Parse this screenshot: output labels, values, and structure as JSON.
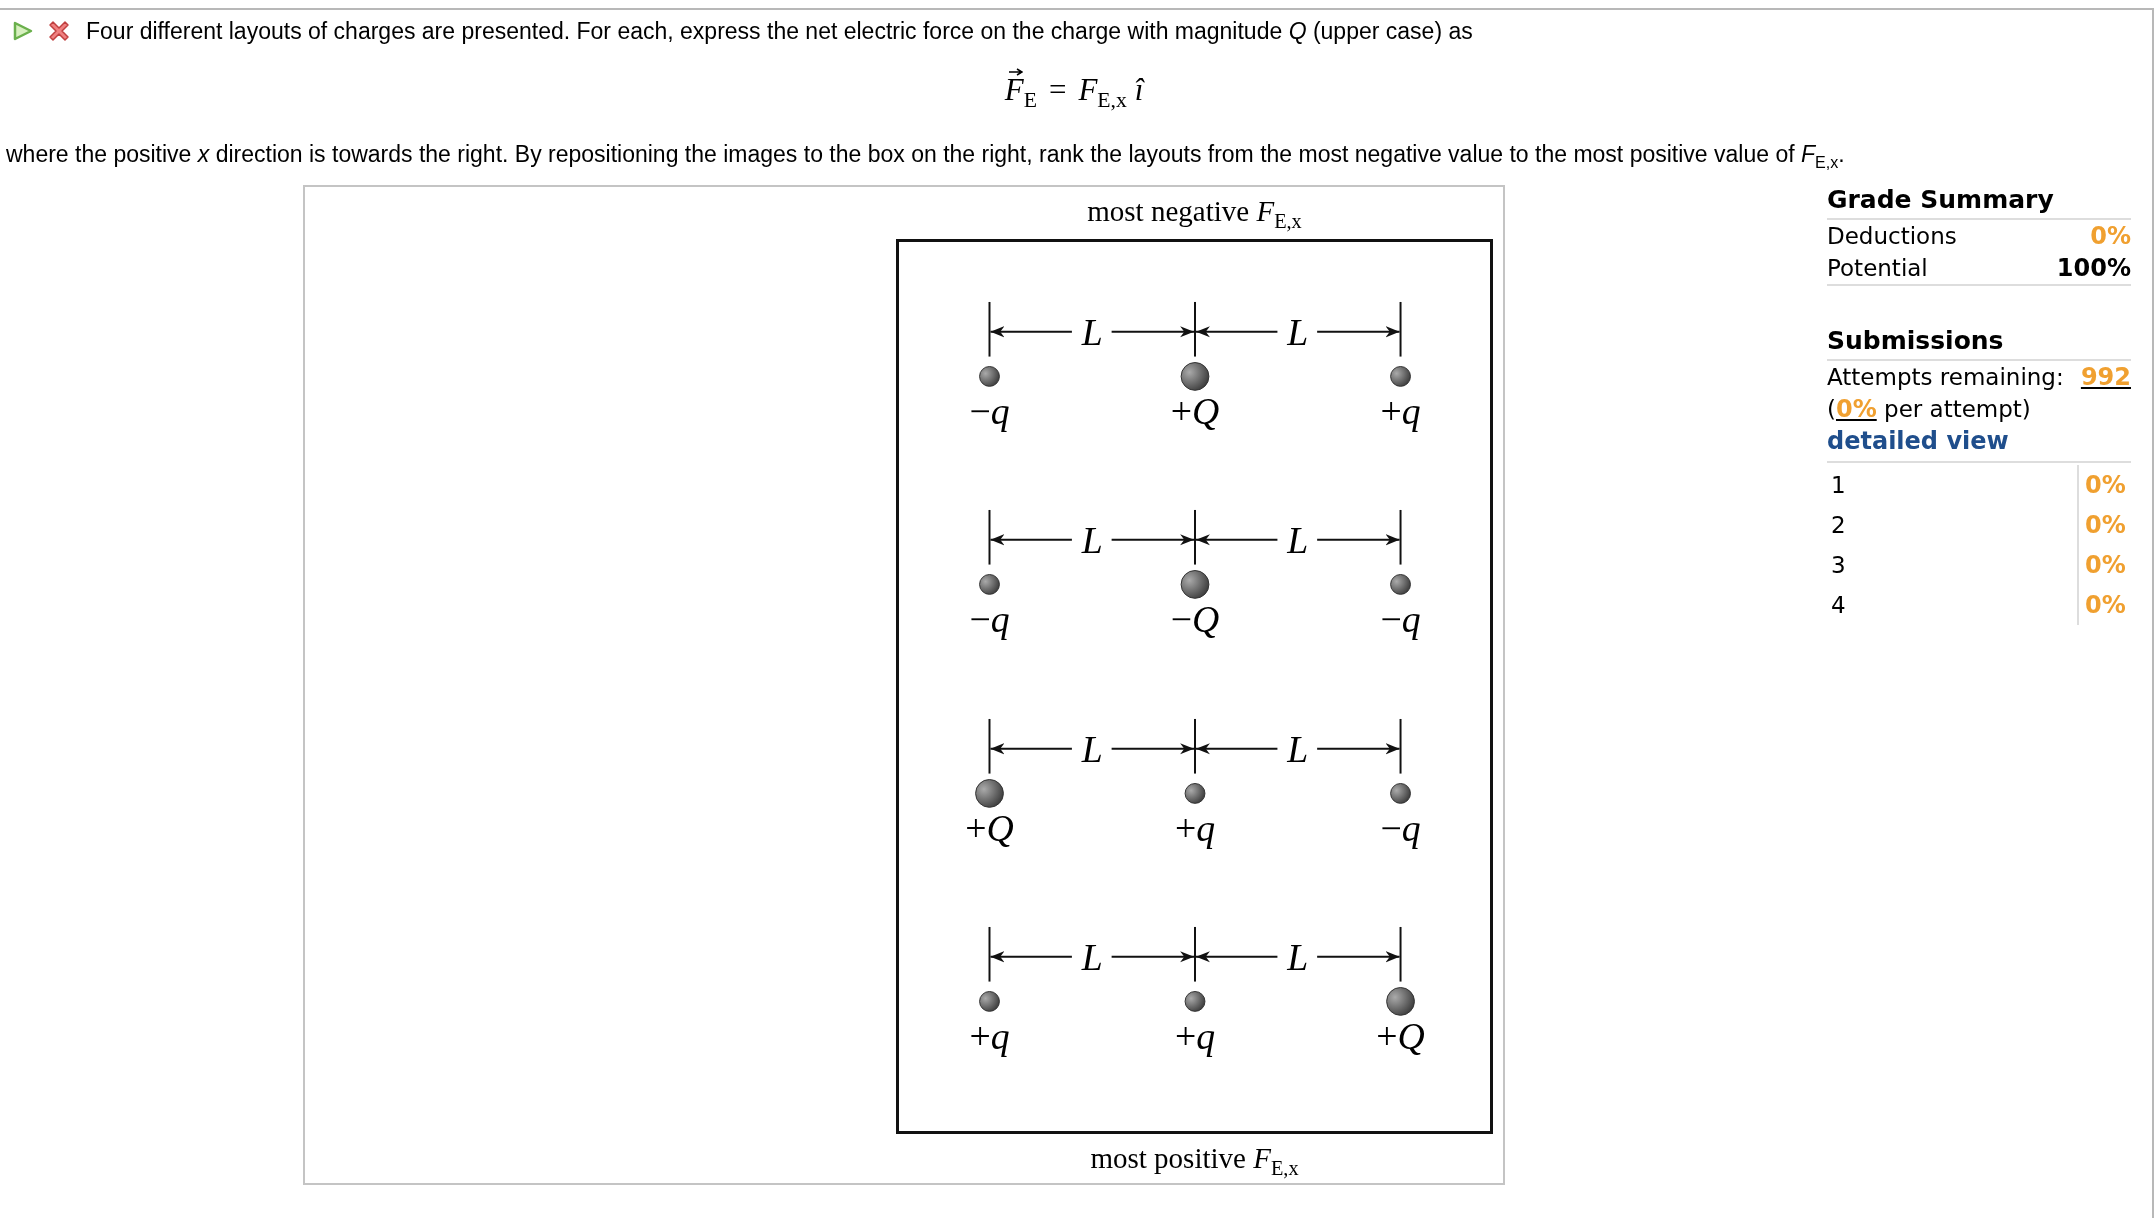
{
  "header": {
    "text": "Four different layouts of charges are presented. For each, express the net electric force on the charge with magnitude *Q* (upper case) as"
  },
  "equation": {
    "lhs": "*F*$_{E}$",
    "relation": "=",
    "rhs": "*F*$_{E,x}$ *î*"
  },
  "instructions": "where the positive *x* direction is towards the right. By repositioning the images to the box on the right, rank the layouts from the most negative value to the most positive value of *F*$_{E,x}$.",
  "ranking": {
    "top_label": "most negative *F*$_{E,x}$",
    "bottom_label": "most positive *F*$_{E,x}$",
    "layouts": [
      {
        "spacings": [
          "L",
          "L"
        ],
        "charges": [
          {
            "sign": "−",
            "symbol": "q",
            "kind": "small"
          },
          {
            "sign": "+",
            "symbol": "Q",
            "kind": "large"
          },
          {
            "sign": "+",
            "symbol": "q",
            "kind": "small"
          }
        ]
      },
      {
        "spacings": [
          "L",
          "L"
        ],
        "charges": [
          {
            "sign": "−",
            "symbol": "q",
            "kind": "small"
          },
          {
            "sign": "−",
            "symbol": "Q",
            "kind": "large"
          },
          {
            "sign": "−",
            "symbol": "q",
            "kind": "small"
          }
        ]
      },
      {
        "spacings": [
          "L",
          "L"
        ],
        "charges": [
          {
            "sign": "+",
            "symbol": "Q",
            "kind": "large"
          },
          {
            "sign": "+",
            "symbol": "q",
            "kind": "small"
          },
          {
            "sign": "−",
            "symbol": "q",
            "kind": "small"
          }
        ]
      },
      {
        "spacings": [
          "L",
          "L"
        ],
        "charges": [
          {
            "sign": "+",
            "symbol": "q",
            "kind": "small"
          },
          {
            "sign": "+",
            "symbol": "q",
            "kind": "small"
          },
          {
            "sign": "+",
            "symbol": "Q",
            "kind": "large"
          }
        ]
      }
    ]
  },
  "grade_summary": {
    "title": "Grade Summary",
    "rows": [
      {
        "label": "Deductions",
        "value": "0%",
        "color": "#f0a030"
      },
      {
        "label": "Potential",
        "value": "100%",
        "color": "#000000"
      }
    ]
  },
  "submissions": {
    "title": "Submissions",
    "attempts_label": "Attempts remaining:",
    "attempts_value": "992",
    "per_attempt": {
      "before": "(",
      "value": "0%",
      "after": " per attempt)"
    },
    "detailed_link": "detailed view",
    "attempts": [
      {
        "number": "1",
        "score": "0%"
      },
      {
        "number": "2",
        "score": "0%"
      },
      {
        "number": "3",
        "score": "0%"
      },
      {
        "number": "4",
        "score": "0%"
      }
    ]
  }
}
